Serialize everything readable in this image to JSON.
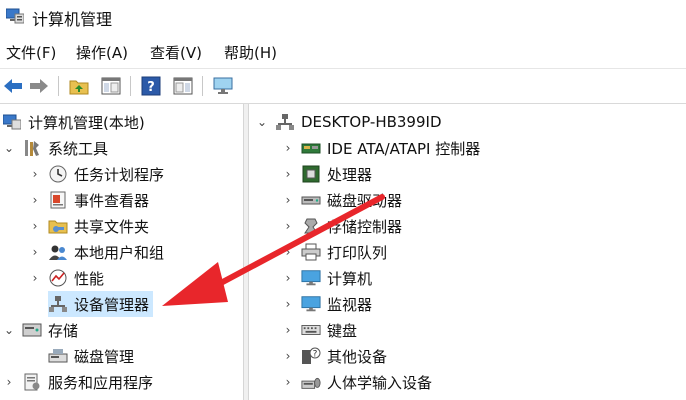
{
  "window": {
    "title": "计算机管理"
  },
  "menu": [
    {
      "label": "文件(F)"
    },
    {
      "label": "操作(A)"
    },
    {
      "label": "查看(V)"
    },
    {
      "label": "帮助(H)"
    }
  ],
  "toolbar": {
    "icons": [
      "back-arrow-icon",
      "forward-arrow-icon",
      "up-folder-icon",
      "show-hide-tree-icon",
      "help-icon",
      "properties-panel-icon",
      "monitor-icon"
    ]
  },
  "left_tree": [
    {
      "label": "计算机管理(本地)",
      "icon": "computer-management-icon",
      "chevron": ""
    },
    {
      "label": "系统工具",
      "icon": "tools-icon",
      "chevron": "⌄"
    },
    {
      "label": "任务计划程序",
      "icon": "clock-icon",
      "chevron": "›"
    },
    {
      "label": "事件查看器",
      "icon": "event-viewer-icon",
      "chevron": "›"
    },
    {
      "label": "共享文件夹",
      "icon": "shared-folder-icon",
      "chevron": "›"
    },
    {
      "label": "本地用户和组",
      "icon": "users-icon",
      "chevron": "›"
    },
    {
      "label": "性能",
      "icon": "performance-icon",
      "chevron": "›"
    },
    {
      "label": "设备管理器",
      "icon": "device-manager-icon",
      "chevron": ""
    },
    {
      "label": "存储",
      "icon": "storage-icon",
      "chevron": "⌄"
    },
    {
      "label": "磁盘管理",
      "icon": "disk-management-icon",
      "chevron": ""
    },
    {
      "label": "服务和应用程序",
      "icon": "services-icon",
      "chevron": "›"
    }
  ],
  "right_tree": {
    "root": {
      "label": "DESKTOP-HB399ID",
      "icon": "computer-icon",
      "chevron": "⌄"
    },
    "items": [
      {
        "label": "IDE ATA/ATAPI 控制器",
        "icon": "ide-controller-icon"
      },
      {
        "label": "处理器",
        "icon": "processor-icon"
      },
      {
        "label": "磁盘驱动器",
        "icon": "disk-drive-icon"
      },
      {
        "label": "存储控制器",
        "icon": "storage-controller-icon"
      },
      {
        "label": "打印队列",
        "icon": "printer-icon"
      },
      {
        "label": "计算机",
        "icon": "computer-monitor-icon"
      },
      {
        "label": "监视器",
        "icon": "monitor-icon"
      },
      {
        "label": "键盘",
        "icon": "keyboard-icon"
      },
      {
        "label": "其他设备",
        "icon": "other-devices-icon"
      },
      {
        "label": "人体学输入设备",
        "icon": "hid-icon"
      }
    ],
    "chevron": "›"
  },
  "annotation": {
    "icon": "red-arrow-icon",
    "color": "#e8262b"
  },
  "colors": {
    "selection": "#cce8ff",
    "arrow": "#e8262b"
  }
}
